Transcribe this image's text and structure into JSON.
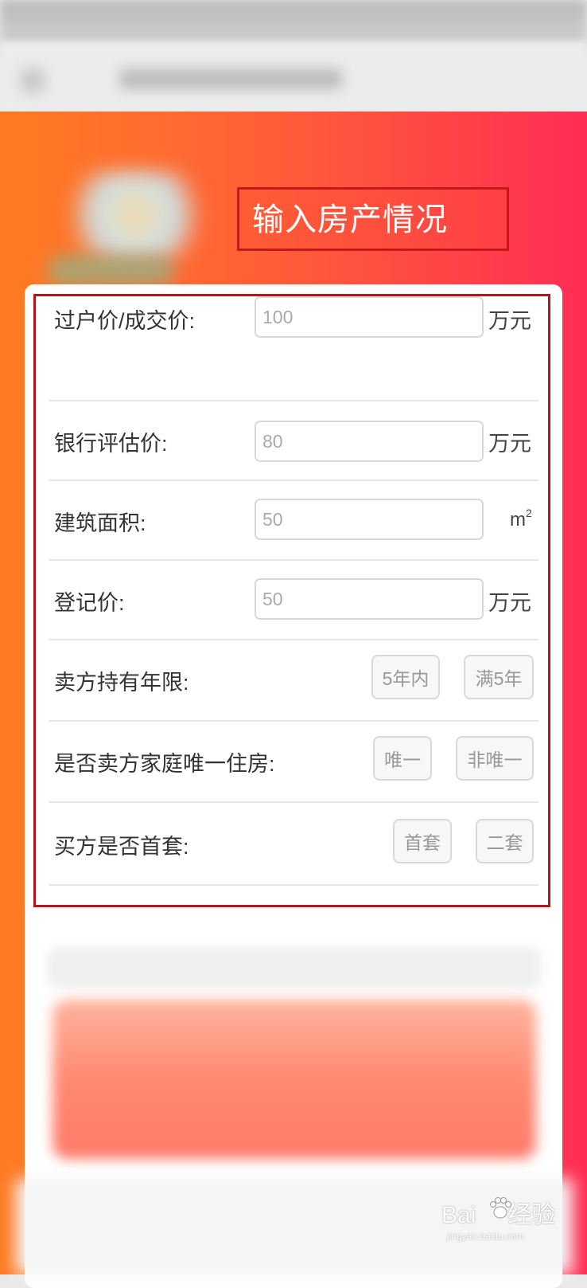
{
  "title": "输入房产情况",
  "form": {
    "transfer_price": {
      "label": "过户价/成交价:",
      "placeholder": "100",
      "unit": "万元"
    },
    "bank_valuation": {
      "label": "银行评估价:",
      "placeholder": "80",
      "unit": "万元"
    },
    "building_area": {
      "label": "建筑面积:",
      "placeholder": "50",
      "unit": "m",
      "unit_sup": "2"
    },
    "registered_price": {
      "label": "登记价:",
      "placeholder": "50",
      "unit": "万元"
    },
    "holding_years": {
      "label": "卖方持有年限:",
      "options": [
        "5年内",
        "满5年"
      ]
    },
    "only_home": {
      "label": "是否卖方家庭唯一住房:",
      "options": [
        "唯一",
        "非唯一"
      ]
    },
    "first_home": {
      "label": "买方是否首套:",
      "options": [
        "首套",
        "二套"
      ]
    }
  },
  "watermark": {
    "text": "Bai",
    "text2": "经验",
    "sub": "jingyan.baidu.com"
  },
  "colors": {
    "annotation_red": "#c3191b",
    "bg_gradient_left": "#ff7b22",
    "bg_gradient_right": "#ff2d55"
  }
}
